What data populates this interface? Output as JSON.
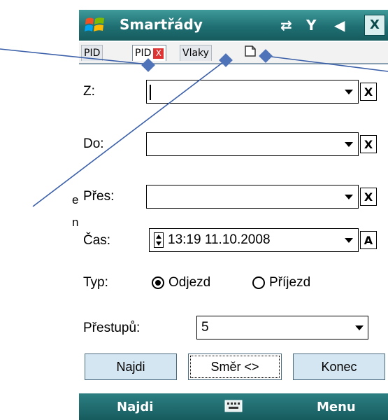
{
  "window": {
    "title": "Smartřády",
    "close_label": "X"
  },
  "tabs": [
    {
      "label": "PID",
      "state": "inactive"
    },
    {
      "label": "PID",
      "state": "active",
      "close_label": "X"
    },
    {
      "label": "Vlaky",
      "state": "inactive"
    }
  ],
  "form": {
    "from_label": "Z:",
    "to_label": "Do:",
    "via_label": "Přes:",
    "time_label": "Čas:",
    "time_value": "13:19  11.10.2008",
    "type_label": "Typ:",
    "departure_label": "Odjezd",
    "arrival_label": "Příjezd",
    "selected_type": "Odjezd",
    "transfers_label": "Přestupů:",
    "transfers_value": "5",
    "clear_label": "X",
    "now_label": "A"
  },
  "buttons": {
    "find": "Najdi",
    "direction": "Směr <>",
    "end": "Konec"
  },
  "softkeys": {
    "left": "Najdi",
    "right": "Menu"
  },
  "outside_text": {
    "line1": "e",
    "line2": "n"
  },
  "colors": {
    "titlebar": "#1f6f72",
    "button_fill": "#d4e6f2",
    "callout": "#3a5fa8"
  }
}
